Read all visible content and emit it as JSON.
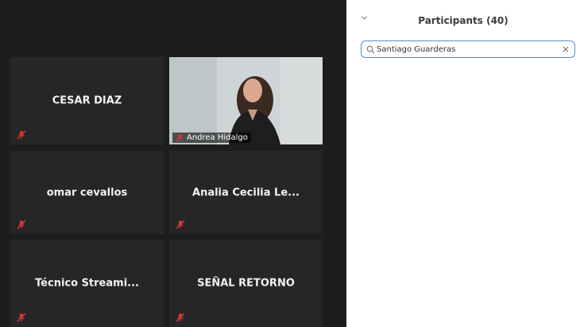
{
  "colors": {
    "gallery_background": "#1d1d1d",
    "tile_background": "#262626",
    "muted_mic": "#d93838",
    "search_border": "#5b8ad8"
  },
  "gallery": {
    "tiles": [
      {
        "name": "CESAR DIAZ",
        "muted": true
      },
      {
        "name": "Andrea Hidalgo",
        "muted": true,
        "video": true
      },
      {
        "name": "omar cevallos",
        "muted": true
      },
      {
        "name": "Analia Cecilia Le...",
        "muted": true
      },
      {
        "name": "Técnico Streami...",
        "muted": true
      },
      {
        "name": "SEÑAL RETORNO",
        "muted": true
      }
    ]
  },
  "panel": {
    "title": "Participants (40)",
    "collapse_icon": "chevron-down-icon",
    "search": {
      "value": "Santiago Guarderas",
      "icon": "search-icon",
      "clear_symbol": "×"
    }
  }
}
